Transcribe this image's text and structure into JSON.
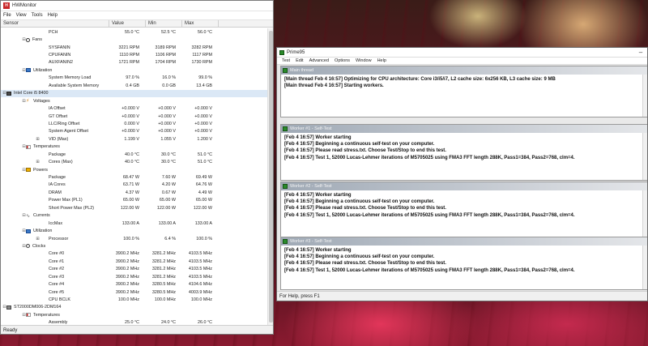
{
  "hwmonitor": {
    "title": "HWMonitor",
    "menu": [
      "File",
      "View",
      "Tools",
      "Help"
    ],
    "columns": {
      "sensor": "Sensor",
      "value": "Value",
      "min": "Min",
      "max": "Max"
    },
    "rows": [
      {
        "indent": 2,
        "icon": "none",
        "name": "PCH",
        "value": "55.0 °C",
        "min": "52.5 °C",
        "max": "56.0 °C"
      },
      {
        "indent": 1,
        "icon": "fan-icon",
        "twisty": "⊟",
        "name": "Fans"
      },
      {
        "indent": 2,
        "icon": "none",
        "name": "SYSFANIN",
        "value": "3221 RPM",
        "min": "3189 RPM",
        "max": "3282 RPM"
      },
      {
        "indent": 2,
        "icon": "none",
        "name": "CPUFANIN",
        "value": "1110 RPM",
        "min": "1106 RPM",
        "max": "1117 RPM"
      },
      {
        "indent": 2,
        "icon": "none",
        "name": "AUXFANIN2",
        "value": "1721 RPM",
        "min": "1704 RPM",
        "max": "1730 RPM"
      },
      {
        "indent": 1,
        "icon": "bar-icon",
        "twisty": "⊟",
        "name": "Utilization"
      },
      {
        "indent": 2,
        "icon": "none",
        "name": "System Memory Load",
        "value": "97.0 %",
        "min": "16.0 %",
        "max": "99.0 %"
      },
      {
        "indent": 2,
        "icon": "none",
        "name": "Available System Memory",
        "value": "0.4 GB",
        "min": "0.0 GB",
        "max": "13.4 GB"
      },
      {
        "indent": 0,
        "icon": "chip-icon",
        "twisty": "⊟",
        "name": "Intel Core i5 8400",
        "highlight": true
      },
      {
        "indent": 1,
        "icon": "voltage-icon",
        "twisty": "⊟",
        "name": "Voltages"
      },
      {
        "indent": 2,
        "icon": "none",
        "name": "IA Offset",
        "value": "+0.000 V",
        "min": "+0.000 V",
        "max": "+0.000 V"
      },
      {
        "indent": 2,
        "icon": "none",
        "name": "GT Offset",
        "value": "+0.000 V",
        "min": "+0.000 V",
        "max": "+0.000 V"
      },
      {
        "indent": 2,
        "icon": "none",
        "name": "LLC/Ring Offset",
        "value": "0.000 V",
        "min": "+0.000 V",
        "max": "+0.000 V"
      },
      {
        "indent": 2,
        "icon": "none",
        "name": "System Agent Offset",
        "value": "+0.000 V",
        "min": "+0.000 V",
        "max": "+0.000 V"
      },
      {
        "indent": 2,
        "icon": "none",
        "twisty": "⊞",
        "name": "VID (Max)",
        "value": "1.199 V",
        "min": "1.055 V",
        "max": "1.200 V"
      },
      {
        "indent": 1,
        "icon": "temperature-icon",
        "twisty": "⊟",
        "name": "Temperatures"
      },
      {
        "indent": 2,
        "icon": "none",
        "name": "Package",
        "value": "40.0 °C",
        "min": "30.0 °C",
        "max": "51.0 °C"
      },
      {
        "indent": 2,
        "icon": "none",
        "twisty": "⊞",
        "name": "Cores (Max)",
        "value": "40.0 °C",
        "min": "30.0 °C",
        "max": "51.0 °C"
      },
      {
        "indent": 1,
        "icon": "power-icon",
        "twisty": "⊟",
        "name": "Powers"
      },
      {
        "indent": 2,
        "icon": "none",
        "name": "Package",
        "value": "68.47 W",
        "min": "7.60 W",
        "max": "69.49 W"
      },
      {
        "indent": 2,
        "icon": "none",
        "name": "IA Cores",
        "value": "63.71 W",
        "min": "4.20 W",
        "max": "64.76 W"
      },
      {
        "indent": 2,
        "icon": "none",
        "name": "DRAM",
        "value": "4.37 W",
        "min": "0.67 W",
        "max": "4.49 W"
      },
      {
        "indent": 2,
        "icon": "none",
        "name": "Power Max (PL1)",
        "value": "65.00 W",
        "min": "65.00 W",
        "max": "65.00 W"
      },
      {
        "indent": 2,
        "icon": "none",
        "name": "Short Power Max (PL2)",
        "value": "122.00 W",
        "min": "122.00 W",
        "max": "122.00 W"
      },
      {
        "indent": 1,
        "icon": "current-icon",
        "twisty": "⊟",
        "name": "Currents"
      },
      {
        "indent": 2,
        "icon": "none",
        "name": "IccMax",
        "value": "133.00 A",
        "min": "133.00 A",
        "max": "133.00 A"
      },
      {
        "indent": 1,
        "icon": "bar-icon",
        "twisty": "⊟",
        "name": "Utilization"
      },
      {
        "indent": 2,
        "icon": "none",
        "twisty": "⊞",
        "name": "Processor",
        "value": "100.0 %",
        "min": "6.4 %",
        "max": "100.0 %"
      },
      {
        "indent": 1,
        "icon": "clock-icon",
        "twisty": "⊟",
        "name": "Clocks"
      },
      {
        "indent": 2,
        "icon": "none",
        "name": "Core #0",
        "value": "3900.2 MHz",
        "min": "3281.2 MHz",
        "max": "4103.5 MHz"
      },
      {
        "indent": 2,
        "icon": "none",
        "name": "Core #1",
        "value": "3900.2 MHz",
        "min": "3281.2 MHz",
        "max": "4103.5 MHz"
      },
      {
        "indent": 2,
        "icon": "none",
        "name": "Core #2",
        "value": "3900.2 MHz",
        "min": "3281.2 MHz",
        "max": "4103.5 MHz"
      },
      {
        "indent": 2,
        "icon": "none",
        "name": "Core #3",
        "value": "3900.2 MHz",
        "min": "3281.2 MHz",
        "max": "4103.5 MHz"
      },
      {
        "indent": 2,
        "icon": "none",
        "name": "Core #4",
        "value": "3900.2 MHz",
        "min": "3280.5 MHz",
        "max": "4104.6 MHz"
      },
      {
        "indent": 2,
        "icon": "none",
        "name": "Core #5",
        "value": "3900.2 MHz",
        "min": "3280.5 MHz",
        "max": "4003.9 MHz"
      },
      {
        "indent": 2,
        "icon": "none",
        "name": "CPU BCLK",
        "value": "100.0 MHz",
        "min": "100.0 MHz",
        "max": "100.0 MHz"
      },
      {
        "indent": 0,
        "icon": "disk-icon",
        "twisty": "⊟",
        "name": "ST2000DM006-2DM164"
      },
      {
        "indent": 1,
        "icon": "temperature-icon",
        "twisty": "⊟",
        "name": "Temperatures"
      },
      {
        "indent": 2,
        "icon": "none",
        "name": "Assembly",
        "value": "25.0 °C",
        "min": "24.0 °C",
        "max": "26.0 °C"
      }
    ],
    "status": "Ready"
  },
  "prime95": {
    "title": "Prime95",
    "menu": [
      "Test",
      "Edit",
      "Advanced",
      "Options",
      "Window",
      "Help"
    ],
    "status": "For Help, press F1",
    "panes": [
      {
        "title": "Main thread",
        "lines": [
          "[Main thread Feb 4 16:57] Optimizing for CPU architecture: Core i3/i5/i7, L2 cache size: 6x256 KB, L3 cache size: 9 MB",
          "[Main thread Feb 4 16:57] Starting workers."
        ]
      },
      {
        "title": "Worker #1 - Self-Test",
        "lines": [
          "[Feb 4 16:57] Worker starting",
          "[Feb 4 16:57] Beginning a continuous self-test on your computer.",
          "[Feb 4 16:57] Please read stress.txt.  Choose Test/Stop to end this test.",
          "[Feb 4 16:57] Test 1, 52000 Lucas-Lehmer iterations of M5705025 using FMA3 FFT length 288K, Pass1=384, Pass2=768, clm=4."
        ]
      },
      {
        "title": "Worker #2 - Self-Test",
        "lines": [
          "[Feb 4 16:57] Worker starting",
          "[Feb 4 16:57] Beginning a continuous self-test on your computer.",
          "[Feb 4 16:57] Please read stress.txt.  Choose Test/Stop to end this test.",
          "[Feb 4 16:57] Test 1, 52000 Lucas-Lehmer iterations of M5705025 using FMA3 FFT length 288K, Pass1=384, Pass2=768, clm=4."
        ]
      },
      {
        "title": "Worker #3 - Self-Test",
        "lines": [
          "[Feb 4 16:57] Worker starting",
          "[Feb 4 16:57] Beginning a continuous self-test on your computer.",
          "[Feb 4 16:57] Please read stress.txt.  Choose Test/Stop to end this test.",
          "[Feb 4 16:57] Test 1, 52000 Lucas-Lehmer iterations of M5705025 using FMA3 FFT length 288K, Pass1=384, Pass2=768, clm=4."
        ]
      }
    ]
  }
}
